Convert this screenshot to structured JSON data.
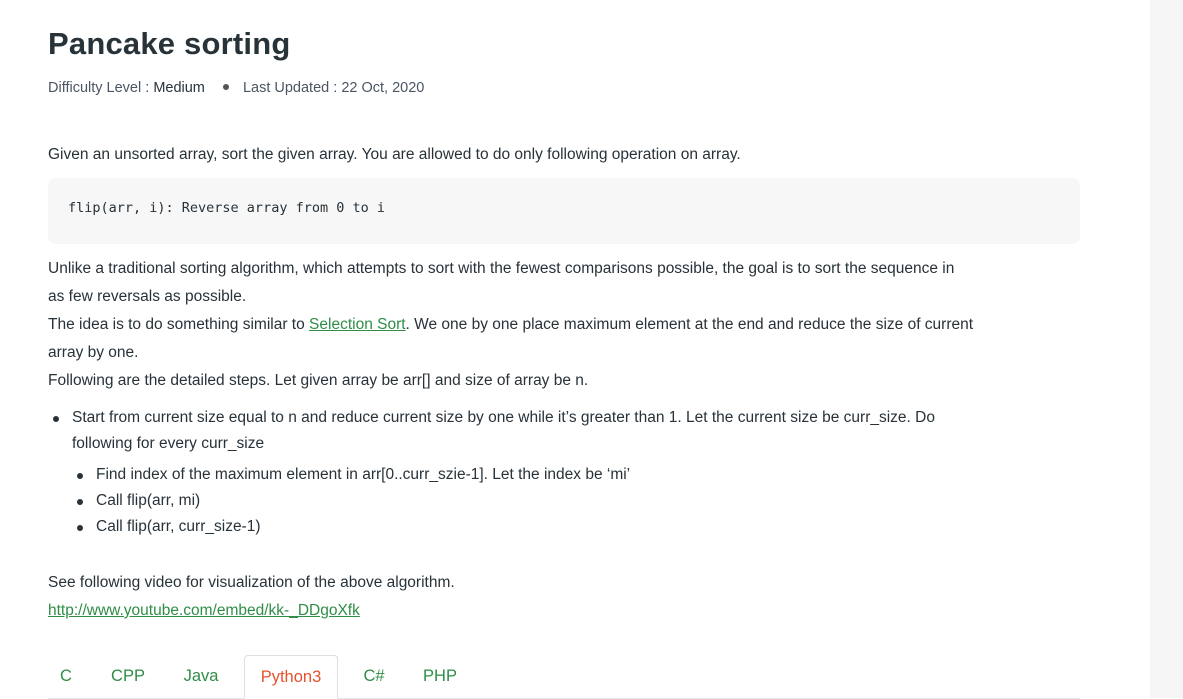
{
  "article": {
    "title": "Pancake sorting",
    "difficulty_label": "Difficulty Level :",
    "difficulty_value": "Medium",
    "updated_label": "Last Updated :",
    "updated_value": "22 Oct, 2020"
  },
  "body": {
    "intro": "Given an unsorted array, sort the given array. You are allowed to do only following operation on array.",
    "code": "flip(arr, i): Reverse array from 0 to i",
    "para1_line1": "Unlike a traditional sorting algorithm, which attempts to sort with the fewest comparisons possible, the goal is to sort the sequence in",
    "para1_line2": "as few reversals as possible.",
    "idea_prefix": "The idea is to do something similar to ",
    "idea_link": "Selection Sort",
    "idea_suffix": ". We one by one place maximum element at the end and reduce the size of current",
    "idea_line2": "array by one.",
    "steps_intro": "Following are the detailed steps. Let given array be arr[] and size of array be n.",
    "bullet_main_line1": "Start from current size equal to n and reduce current size by one while it’s greater than 1. Let the current size be curr_size. Do",
    "bullet_main_line2": "following for every curr_size",
    "sub_bullets": [
      "Find index of the maximum element in arr[0..curr_szie-1]. Let the index be ‘mi’",
      "Call flip(arr, mi)",
      "Call flip(arr, curr_size-1)"
    ],
    "video_text": "See following video for visualization of the above algorithm.",
    "video_link": "http://www.youtube.com/embed/kk-_DDgoXfk"
  },
  "tabs": [
    {
      "label": "C",
      "active": false
    },
    {
      "label": "CPP",
      "active": false
    },
    {
      "label": "Java",
      "active": false
    },
    {
      "label": "Python3",
      "active": true
    },
    {
      "label": "C#",
      "active": false
    },
    {
      "label": "PHP",
      "active": false
    }
  ],
  "colors": {
    "text": "#273239",
    "link": "#2f8d46",
    "active_tab": "#e5532d",
    "code_bg": "#f7f7f7"
  }
}
